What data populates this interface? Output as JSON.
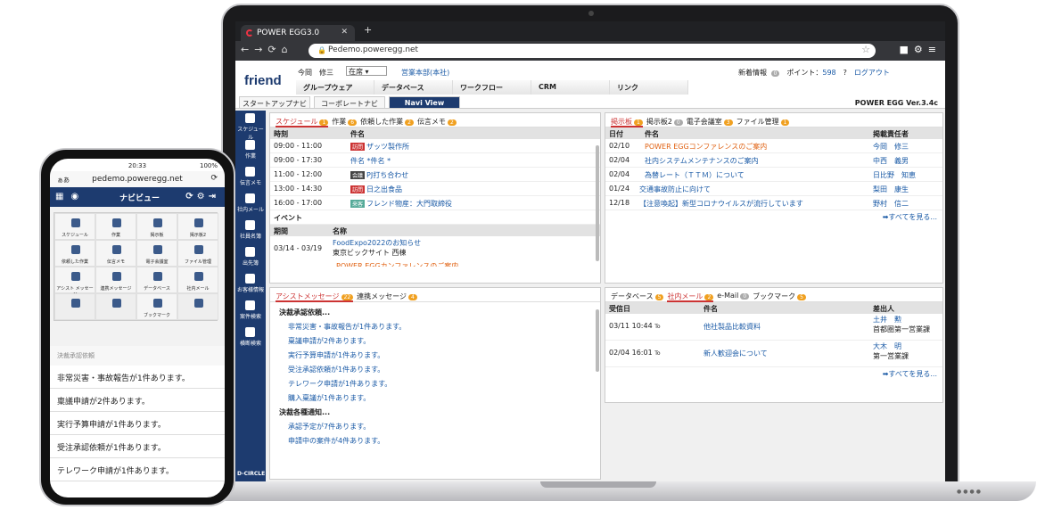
{
  "browser": {
    "tab_title": "POWER EGG3.0",
    "url": "Pedemo.poweregg.net"
  },
  "header": {
    "logo": "friend",
    "user": "今岡　修三",
    "status": "在席",
    "dept": "営業本部(本社)",
    "news": "新着情報",
    "news_count": "0",
    "points_label": "ポイント：",
    "points": "598",
    "help": "?",
    "logout": "ログアウト",
    "version": "POWER EGG Ver.3.4c"
  },
  "menu": [
    "グループウェア",
    "データベース",
    "ワークフロー",
    "CRM",
    "リンク"
  ],
  "subtabs": [
    "スタートアップナビ",
    "コーポレートナビ",
    "Navi View"
  ],
  "sidebar": [
    "スケジュール",
    "作業",
    "伝言メモ",
    "社内メール",
    "社員名簿",
    "出先簿",
    "お客様情報",
    "案件検索",
    "横断検索"
  ],
  "sidebar_logo": "D-CIRCLE",
  "schedule": {
    "tabs": [
      {
        "l": "スケジュール",
        "n": "1"
      },
      {
        "l": "作業",
        "n": "6"
      },
      {
        "l": "依頼した作業",
        "n": "2"
      },
      {
        "l": "伝言メモ",
        "n": "2"
      }
    ],
    "cols": [
      "時刻",
      "件名"
    ],
    "rows": [
      {
        "t": "09:00 - 11:00",
        "tag": "訪問",
        "s": "ザッツ製作所"
      },
      {
        "t": "09:00 - 17:30",
        "tag": "",
        "s": "件名 *件名 *"
      },
      {
        "t": "11:00 - 12:00",
        "tag": "会議",
        "s": "PJ打ち合わせ"
      },
      {
        "t": "13:00 - 14:30",
        "tag": "訪問",
        "s": "日之出食品"
      },
      {
        "t": "16:00 - 17:00",
        "tag": "来客",
        "s": "フレンド物産：大門取締役"
      }
    ],
    "event_label": "イベント",
    "ev_cols": [
      "期間",
      "名称"
    ],
    "ev": [
      {
        "t": "03/14 - 03/19",
        "s1": "FoodExpo2022のお知らせ",
        "s2": "東京ビックサイト 西棟"
      }
    ],
    "ev_cut": "POWER EGGカンファレンスのご案内"
  },
  "board": {
    "tabs": [
      {
        "l": "掲示板",
        "n": "1"
      },
      {
        "l": "掲示板2",
        "n": "0"
      },
      {
        "l": "電子会議室",
        "n": "3"
      },
      {
        "l": "ファイル管理",
        "n": "1"
      }
    ],
    "cols": [
      "日付",
      "件名",
      "掲載責任者"
    ],
    "rows": [
      {
        "d": "02/10",
        "s": "POWER EGGコンファレンスのご案内",
        "p": "今岡　修三"
      },
      {
        "d": "02/04",
        "s": "社内システムメンテナンスのご案内",
        "p": "中西　義男"
      },
      {
        "d": "02/04",
        "s": "為替レート（ＴＴＭ）について",
        "p": "日比野　知恵"
      },
      {
        "d": "01/24",
        "s": "交通事故防止に向けて",
        "p": "梨田　康生"
      },
      {
        "d": "12/18",
        "s": "【注意喚起】新型コロナウイルスが流行しています",
        "p": "野村　信二"
      }
    ],
    "more": "➡すべてを見る..."
  },
  "assist": {
    "tabs": [
      {
        "l": "アシストメッセージ",
        "n": "22"
      },
      {
        "l": "連携メッセージ",
        "n": "4"
      }
    ],
    "g1": "決裁承認依頼...",
    "items1": [
      "非常災害・事故報告が1件あります。",
      "稟議申請が2件あります。",
      "実行予算申請が1件あります。",
      "受注承認依頼が1件あります。",
      "テレワーク申請が1件あります。",
      "購入稟議が1件あります。"
    ],
    "g2": "決裁各種通知...",
    "items2": [
      "承認予定が7件あります。",
      "申請中の案件が4件あります。"
    ]
  },
  "mail": {
    "tabs": [
      {
        "l": "データベース",
        "n": "5"
      },
      {
        "l": "社内メール",
        "n": "2"
      },
      {
        "l": "e-Mail",
        "n": "0"
      },
      {
        "l": "ブックマーク",
        "n": "5"
      }
    ],
    "cols": [
      "受信日",
      "件名",
      "差出人"
    ],
    "rows": [
      {
        "d": "03/11 10:44",
        "to": "To",
        "s": "他社製品比較資料",
        "p": "土井　勲",
        "p2": "首都圏第一営業課"
      },
      {
        "d": "02/04 16:01",
        "to": "To",
        "s": "新人歓迎会について",
        "p": "大木　明",
        "p2": "第一営業課"
      }
    ],
    "more": "➡すべてを見る..."
  },
  "phone": {
    "time": "20:33",
    "battery": "100%",
    "aa": "ぁあ",
    "url": "pedemo.poweregg.net",
    "title": "ナビビュー",
    "tiles": [
      "スケジュール",
      "作業",
      "掲示板",
      "掲示板2",
      "依頼した作業",
      "伝言メモ",
      "電子会議室",
      "ファイル管理",
      "アシスト メッセージ",
      "連携メッセージ",
      "データベース",
      "社内メール",
      "",
      "",
      "ブックマーク",
      ""
    ],
    "section": "決裁承認依頼",
    "items": [
      "非常災害・事故報告が1件あります。",
      "稟議申請が2件あります。",
      "実行予算申請が1件あります。",
      "受注承認依頼が1件あります。",
      "テレワーク申請が1件あります。"
    ]
  }
}
